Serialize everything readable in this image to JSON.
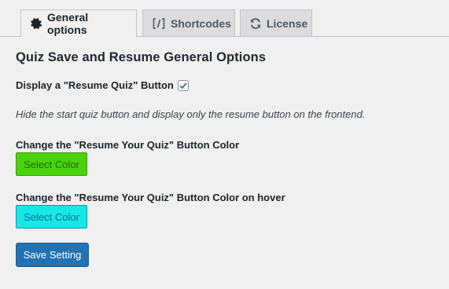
{
  "tabs": [
    {
      "label": "General options",
      "icon": "gear-icon",
      "active": true
    },
    {
      "label": "Shortcodes",
      "icon": "shortcode-brackets-icon",
      "active": false
    },
    {
      "label": "License",
      "icon": "refresh-icon",
      "active": false
    }
  ],
  "page": {
    "title": "Quiz Save and Resume General Options"
  },
  "resume_option": {
    "label": "Display a \"Resume Quiz\" Button",
    "checked": true,
    "description": "Hide the start quiz button and display only the resume button on the frontend."
  },
  "button_color": {
    "label": "Change the \"Resume Your Quiz\" Button Color",
    "button_label": "Select Color",
    "color": "#4cd20b"
  },
  "button_hover_color": {
    "label": "Change the \"Resume Your Quiz\" Button Color on hover",
    "button_label": "Select Color",
    "color": "#16e8e8"
  },
  "actions": {
    "save_label": "Save Setting"
  },
  "colors": {
    "primary": "#2271b1",
    "background": "#f0f0f1",
    "tab_inactive": "#dcdcde"
  }
}
